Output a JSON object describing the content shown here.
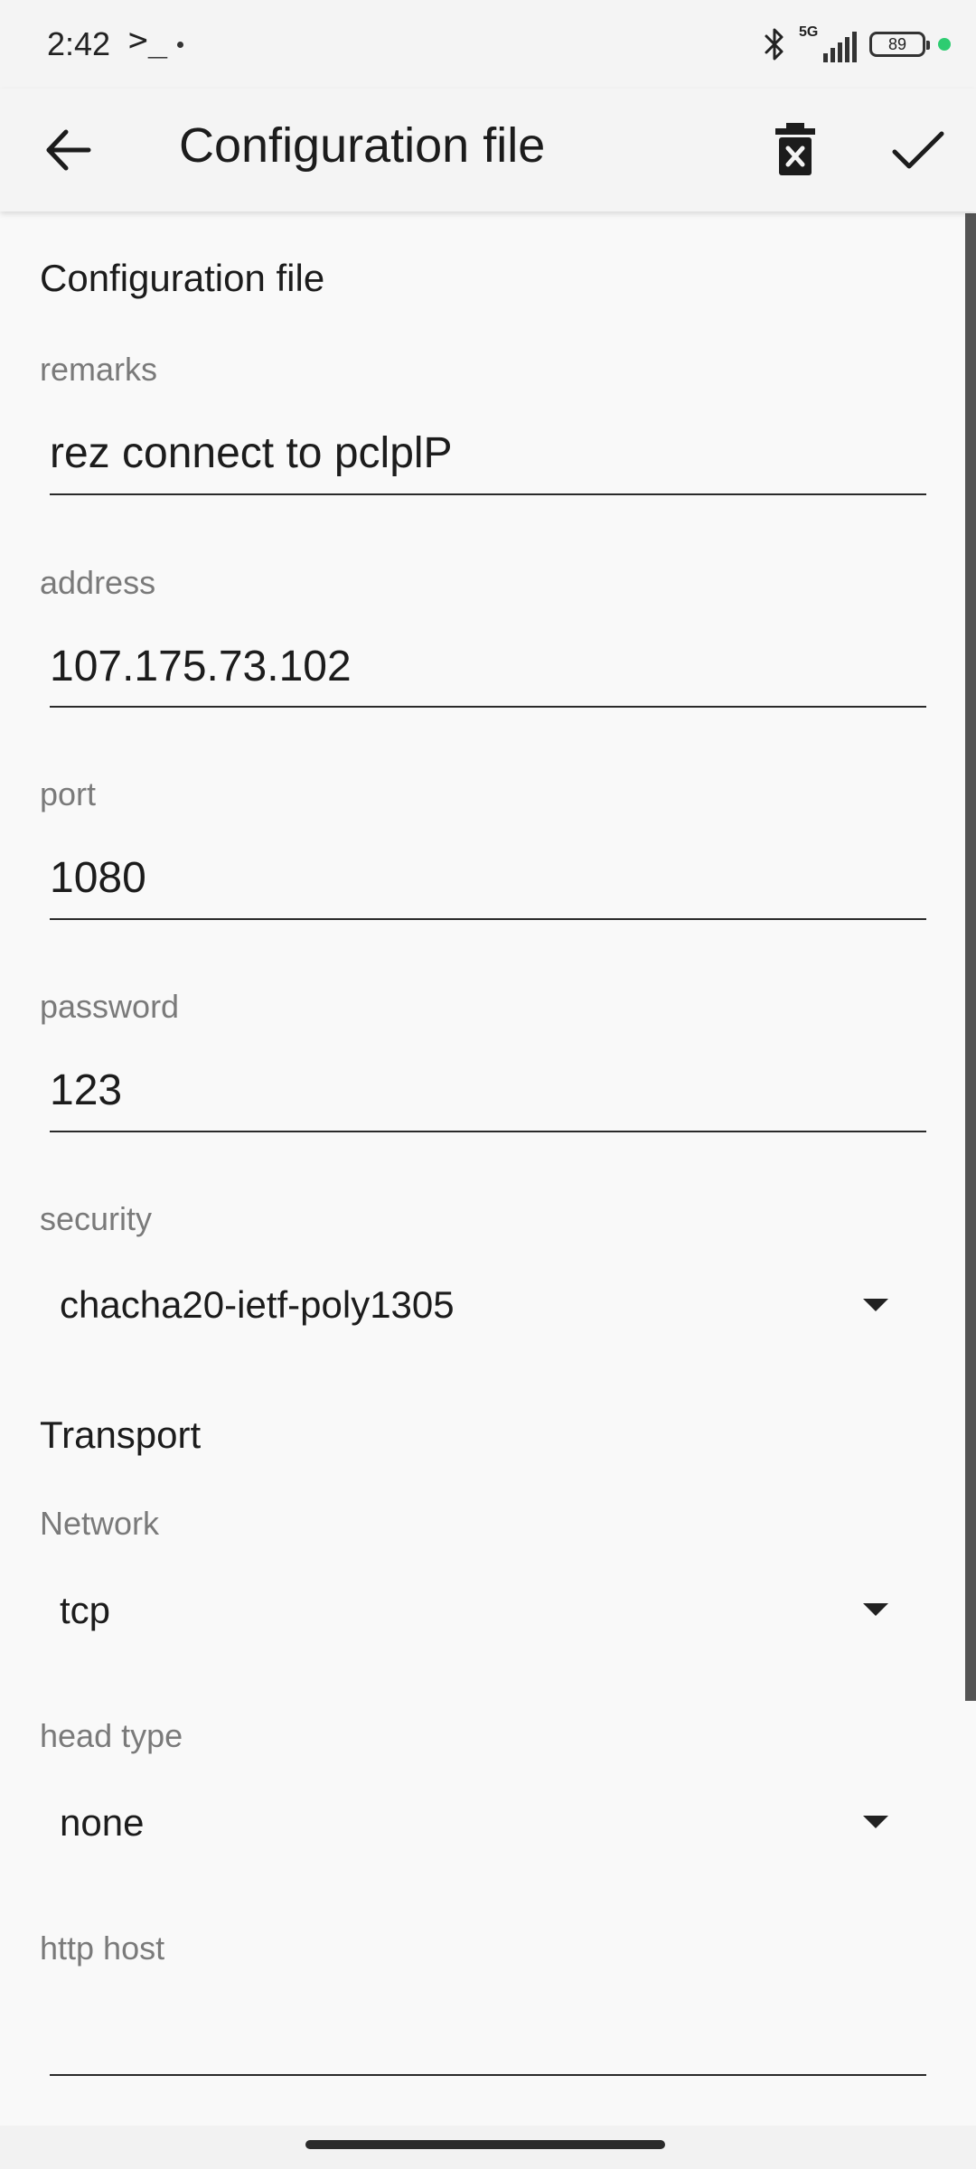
{
  "status_bar": {
    "time": "2:42",
    "prompt_symbol": ">_",
    "network": "5G",
    "battery": "89",
    "icons": [
      "bluetooth-icon",
      "signal-icon",
      "battery-icon",
      "green-dot-icon"
    ],
    "accent_green": "#2ecc71"
  },
  "app_bar": {
    "title": "Configuration file",
    "icons": [
      "back-arrow-icon",
      "delete-icon",
      "check-icon"
    ]
  },
  "form": {
    "section_title": "Configuration file",
    "remarks": {
      "label": "remarks",
      "value": "rez connect to pclplP"
    },
    "address": {
      "label": "address",
      "value": "107.175.73.102"
    },
    "port": {
      "label": "port",
      "value": "1080"
    },
    "password": {
      "label": "password",
      "value": "123"
    },
    "security": {
      "label": "security",
      "value": "chacha20-ietf-poly1305"
    },
    "transport_title": "Transport",
    "network": {
      "label": "Network",
      "value": "tcp"
    },
    "head_type": {
      "label": "head type",
      "value": "none"
    },
    "http_host": {
      "label": "http host",
      "value": ""
    }
  }
}
